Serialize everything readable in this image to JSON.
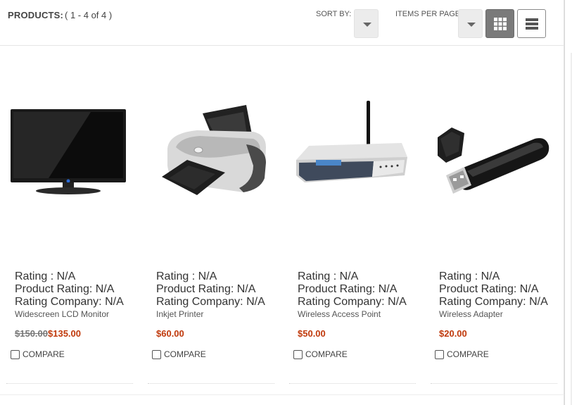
{
  "toolbar": {
    "products_label": "PRODUCTS:",
    "products_range": "(  1 - 4 of 4  )",
    "sort_label": "SORT BY:",
    "items_per_page_label": "ITEMS PER PAGE:",
    "view_modes": [
      "grid",
      "list"
    ],
    "active_view": "grid"
  },
  "products": [
    {
      "image": "lcd-monitor",
      "rating": "Rating : N/A",
      "product_rating": "Product Rating: N/A",
      "rating_company": "Rating Company: N/A",
      "name": "Widescreen LCD Monitor",
      "old_price": "$150.00",
      "price": "$135.00",
      "compare": "COMPARE"
    },
    {
      "image": "inkjet-printer",
      "rating": "Rating : N/A",
      "product_rating": "Product Rating: N/A",
      "rating_company": "Rating Company: N/A",
      "name": "Inkjet Printer",
      "price": "$60.00",
      "compare": "COMPARE"
    },
    {
      "image": "wireless-router",
      "rating": "Rating : N/A",
      "product_rating": "Product Rating: N/A",
      "rating_company": "Rating Company: N/A",
      "name": "Wireless Access Point",
      "price": "$50.00",
      "compare": "COMPARE"
    },
    {
      "image": "usb-wireless-adapter",
      "rating": "Rating : N/A",
      "product_rating": "Product Rating: N/A",
      "rating_company": "Rating Company: N/A",
      "name": "Wireless Adapter",
      "price": "$20.00",
      "compare": "COMPARE"
    }
  ],
  "colors": {
    "price": "#c0390b",
    "active_view_button": "#7a7a7a"
  }
}
